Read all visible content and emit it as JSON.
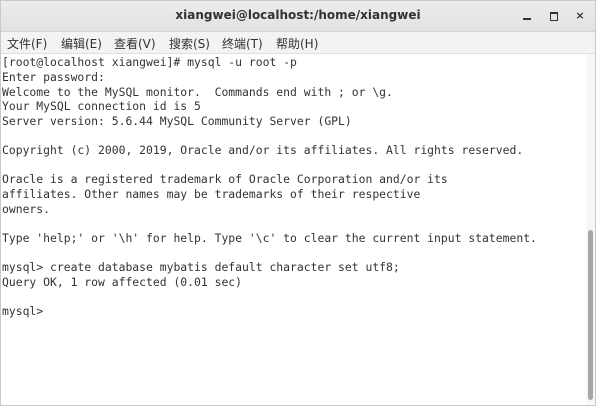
{
  "window": {
    "title": "xiangwei@localhost:/home/xiangwei",
    "minimize_label": "",
    "maximize_label": "",
    "close_label": "×"
  },
  "menu": {
    "items": [
      {
        "label": "文件(F)"
      },
      {
        "label": "编辑(E)"
      },
      {
        "label": "查看(V)"
      },
      {
        "label": "搜索(S)"
      },
      {
        "label": "终端(T)"
      },
      {
        "label": "帮助(H)"
      }
    ]
  },
  "terminal": {
    "lines": [
      "[root@localhost xiangwei]# mysql -u root -p",
      "Enter password:",
      "Welcome to the MySQL monitor.  Commands end with ; or \\g.",
      "Your MySQL connection id is 5",
      "Server version: 5.6.44 MySQL Community Server (GPL)",
      "",
      "Copyright (c) 2000, 2019, Oracle and/or its affiliates. All rights reserved.",
      "",
      "Oracle is a registered trademark of Oracle Corporation and/or its",
      "affiliates. Other names may be trademarks of their respective",
      "owners.",
      "",
      "Type 'help;' or '\\h' for help. Type '\\c' to clear the current input statement.",
      "",
      "mysql> create database mybatis default character set utf8;",
      "Query OK, 1 row affected (0.01 sec)",
      "",
      "mysql>"
    ]
  }
}
